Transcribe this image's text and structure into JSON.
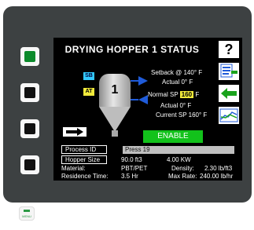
{
  "title": "DRYING HOPPER 1 STATUS",
  "hopper": {
    "number": "1",
    "tag_sb": "SB",
    "tag_at": "AT"
  },
  "setback": {
    "label": "Setback @ 140° F",
    "actual": "Actual     0° F"
  },
  "normal": {
    "label": "Normal SP",
    "value": "160",
    "unit": "F",
    "actual": "Actual     0° F",
    "current_sp": "Current SP 160° F"
  },
  "enable_label": "ENABLE",
  "process_id": {
    "label": "Process ID",
    "value": "Press 19"
  },
  "hopper_size": {
    "label": "Hopper Size",
    "volume": "90.0 ft3",
    "power": "4.00 KW"
  },
  "material": {
    "label": "Material:",
    "value": "PBT/PET",
    "density_label": "Density:",
    "density_value": "2.30 lb/ft3"
  },
  "residence": {
    "label": "Residence Time:",
    "value": "3.5 Hr",
    "maxrate_label": "Max Rate:",
    "maxrate_value": "240.00 lb/hr"
  },
  "help_label": "?",
  "menu_label": "MENU"
}
